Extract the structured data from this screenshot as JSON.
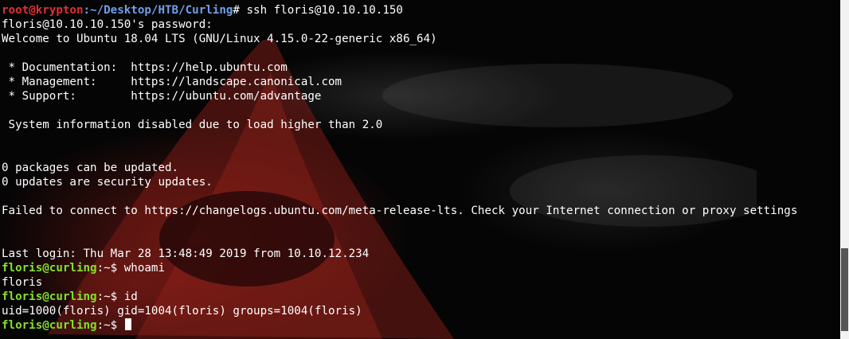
{
  "terminal": {
    "host_prompt": {
      "user_host": "root@krypton",
      "path": ":~/Desktop/HTB/Curling",
      "symbol": "#",
      "command": " ssh floris@10.10.10.150"
    },
    "output_block_1": [
      "floris@10.10.10.150's password:",
      "Welcome to Ubuntu 18.04 LTS (GNU/Linux 4.15.0-22-generic x86_64)",
      "",
      " * Documentation:  https://help.ubuntu.com",
      " * Management:     https://landscape.canonical.com",
      " * Support:        https://ubuntu.com/advantage",
      "",
      " System information disabled due to load higher than 2.0",
      "",
      "",
      "0 packages can be updated.",
      "0 updates are security updates.",
      "",
      "Failed to connect to https://changelogs.ubuntu.com/meta-release-lts. Check your Internet connection or proxy settings",
      "",
      "",
      "Last login: Thu Mar 28 13:48:49 2019 from 10.10.12.234"
    ],
    "remote_prompt": {
      "user_host": "floris@curling",
      "path": ":~$"
    },
    "cmd_whoami": " whoami",
    "out_whoami": "floris",
    "cmd_id": " id",
    "out_id": "uid=1000(floris) gid=1004(floris) groups=1004(floris)"
  },
  "colors": {
    "root_prompt": "#e03030",
    "path": "#6fa0e8",
    "user_prompt": "#86e02a",
    "text": "#ffffff"
  }
}
